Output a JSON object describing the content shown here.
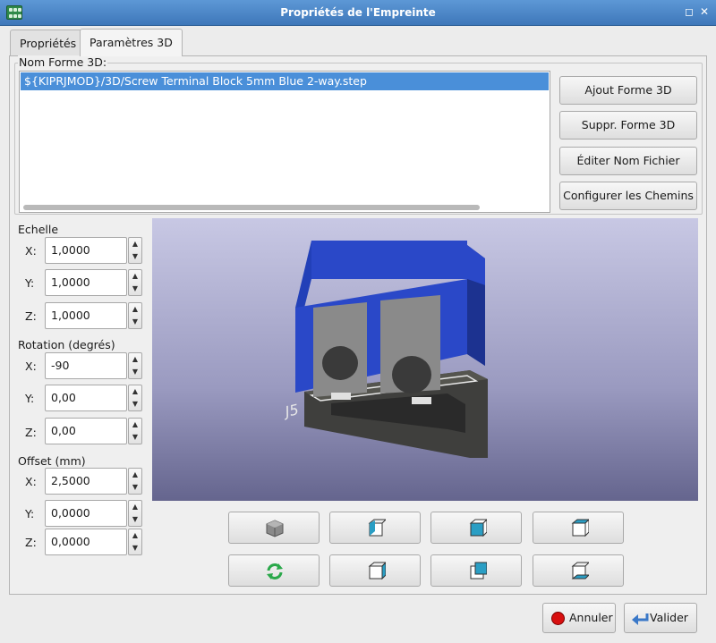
{
  "window": {
    "title": "Propriétés de l'Empreinte",
    "icon": "kicad-footprint-icon",
    "buttons": [
      "restore-icon",
      "close-icon"
    ]
  },
  "tabs": [
    {
      "label": "Propriétés",
      "active": false
    },
    {
      "label": "Paramètres 3D",
      "active": true
    }
  ],
  "shapes": {
    "group_label": "Nom Forme 3D:",
    "items": [
      {
        "label": "${KIPRJMOD}/3D/Screw Terminal Block 5mm Blue 2-way.step",
        "selected": true
      }
    ],
    "buttons": {
      "add": "Ajout Forme 3D",
      "remove": "Suppr. Forme 3D",
      "edit": "Éditer Nom Fichier",
      "paths": "Configurer les Chemins"
    }
  },
  "scale": {
    "label": "Echelle",
    "x_label": "X:",
    "x": "1,0000",
    "y_label": "Y:",
    "y": "1,0000",
    "z_label": "Z:",
    "z": "1,0000"
  },
  "rotation": {
    "label": "Rotation (degrés)",
    "x_label": "X:",
    "x": "-90",
    "y_label": "Y:",
    "y": "0,00",
    "z_label": "Z:",
    "z": "0,00"
  },
  "offset": {
    "label": "Offset (mm)",
    "x_label": "X:",
    "x": "2,5000",
    "y_label": "Y:",
    "y": "0,0000",
    "z_label": "Z:",
    "z": "0,0000"
  },
  "preview": {
    "silkscreen_ref": "J5",
    "body_color": "#2a48c8",
    "pcb_color": "#4a4a48"
  },
  "view_buttons": [
    "view-iso-icon",
    "view-left-icon",
    "view-front-icon",
    "view-top-icon",
    "reload-icon",
    "view-right-icon",
    "view-back-icon",
    "view-bottom-icon"
  ],
  "footer": {
    "cancel": "Annuler",
    "ok": "Valider",
    "cancel_icon": "stop-icon",
    "ok_icon": "enter-arrow-icon"
  },
  "colors": {
    "accent": "#4a8fd9",
    "titlebar": "#4a85c8"
  }
}
